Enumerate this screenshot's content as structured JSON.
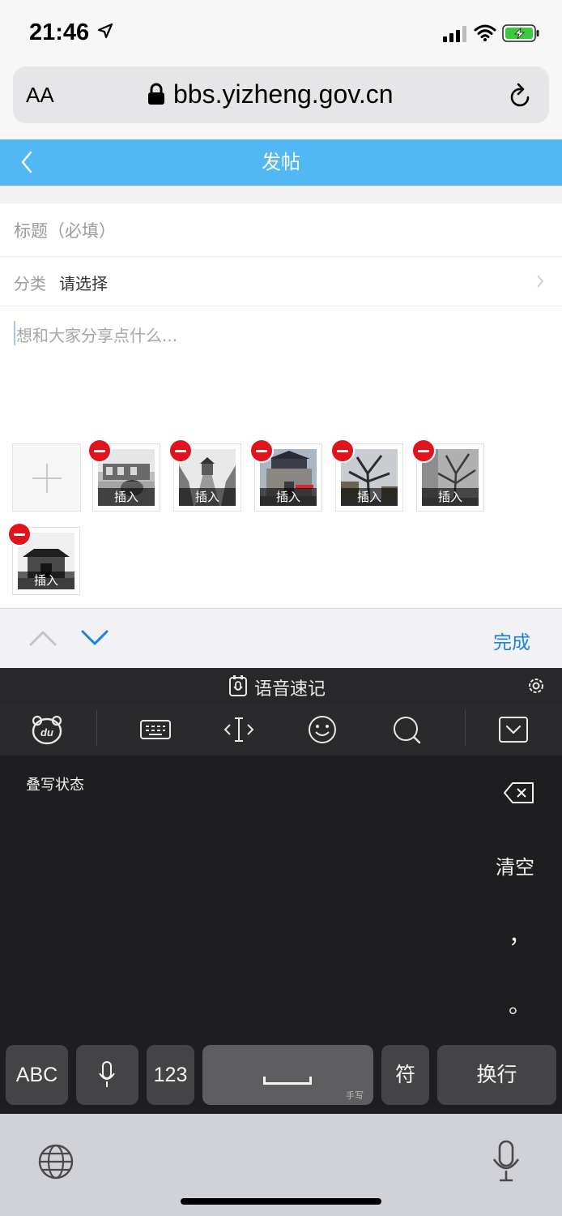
{
  "status_bar": {
    "time": "21:46"
  },
  "browser": {
    "text_size_label": "AA",
    "url": "bbs.yizheng.gov.cn"
  },
  "header": {
    "title": "发帖"
  },
  "form": {
    "title_placeholder": "标题（必填）",
    "category_label": "分类",
    "category_value": "请选择",
    "content_placeholder": "想和大家分享点什么..."
  },
  "images": [
    {
      "insert_label": "插入"
    },
    {
      "insert_label": "插入"
    },
    {
      "insert_label": "插入"
    },
    {
      "insert_label": "插入"
    },
    {
      "insert_label": "插入"
    },
    {
      "insert_label": "插入"
    }
  ],
  "toolbar": {
    "done_label": "完成"
  },
  "keyboard": {
    "voice_label": "语音速记",
    "handwriting_mode": "叠写状态",
    "clear_label": "清空",
    "comma": "，",
    "period": "。",
    "keys": {
      "abc": "ABC",
      "num": "123",
      "symbol": "符",
      "enter": "换行",
      "space_hint": "手写"
    }
  },
  "colors": {
    "header_bg": "#52b8f3",
    "accent": "#1a82e2",
    "delete_badge": "#e1141e"
  }
}
